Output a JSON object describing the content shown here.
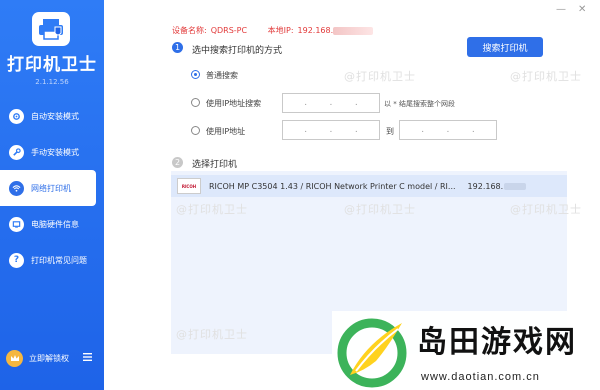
{
  "app": {
    "title": "打印机卫士",
    "version": "2.1.12.56"
  },
  "sidebar": {
    "items": [
      {
        "label": "自动安装模式",
        "icon": "settings-icon",
        "active": false
      },
      {
        "label": "手动安装模式",
        "icon": "wrench-icon",
        "active": false
      },
      {
        "label": "网络打印机",
        "icon": "network-printer-icon",
        "active": true
      },
      {
        "label": "电脑硬件信息",
        "icon": "hardware-icon",
        "active": false
      },
      {
        "label": "打印机常见问题",
        "icon": "question-icon",
        "active": false
      }
    ],
    "unlock_label": "立即解锁权"
  },
  "window_controls": {
    "minimize": "—",
    "close": "✕"
  },
  "device_info": {
    "device_label": "设备名称:",
    "device_name": "QDRS-PC",
    "ip_label": "本地IP:",
    "ip_value": "192.168."
  },
  "step1": {
    "number": "1",
    "title": "选中搜索打印机的方式",
    "search_button": "搜索打印机",
    "options": [
      {
        "label": "普通搜索",
        "checked": true
      },
      {
        "label": "使用IP地址搜索",
        "checked": false,
        "hint": "以 * 结尾搜索整个网段"
      },
      {
        "label": "使用IP地址",
        "checked": false,
        "to_label": "到"
      }
    ]
  },
  "step2": {
    "number": "2",
    "title": "选择打印机",
    "printers": [
      {
        "brand": "RICOH",
        "name": "RICOH MP C3504 1.43 / RICOH Network Printer C model / RI...",
        "ip": "192.168."
      }
    ]
  },
  "watermark_text": "@打印机卫士",
  "site": {
    "name": "岛田游戏网",
    "url": "www.daotian.com.cn"
  },
  "colors": {
    "sidebar_blue": "#2f7cf6",
    "accent": "#2f6fe8",
    "info_red": "#e23a3a"
  }
}
